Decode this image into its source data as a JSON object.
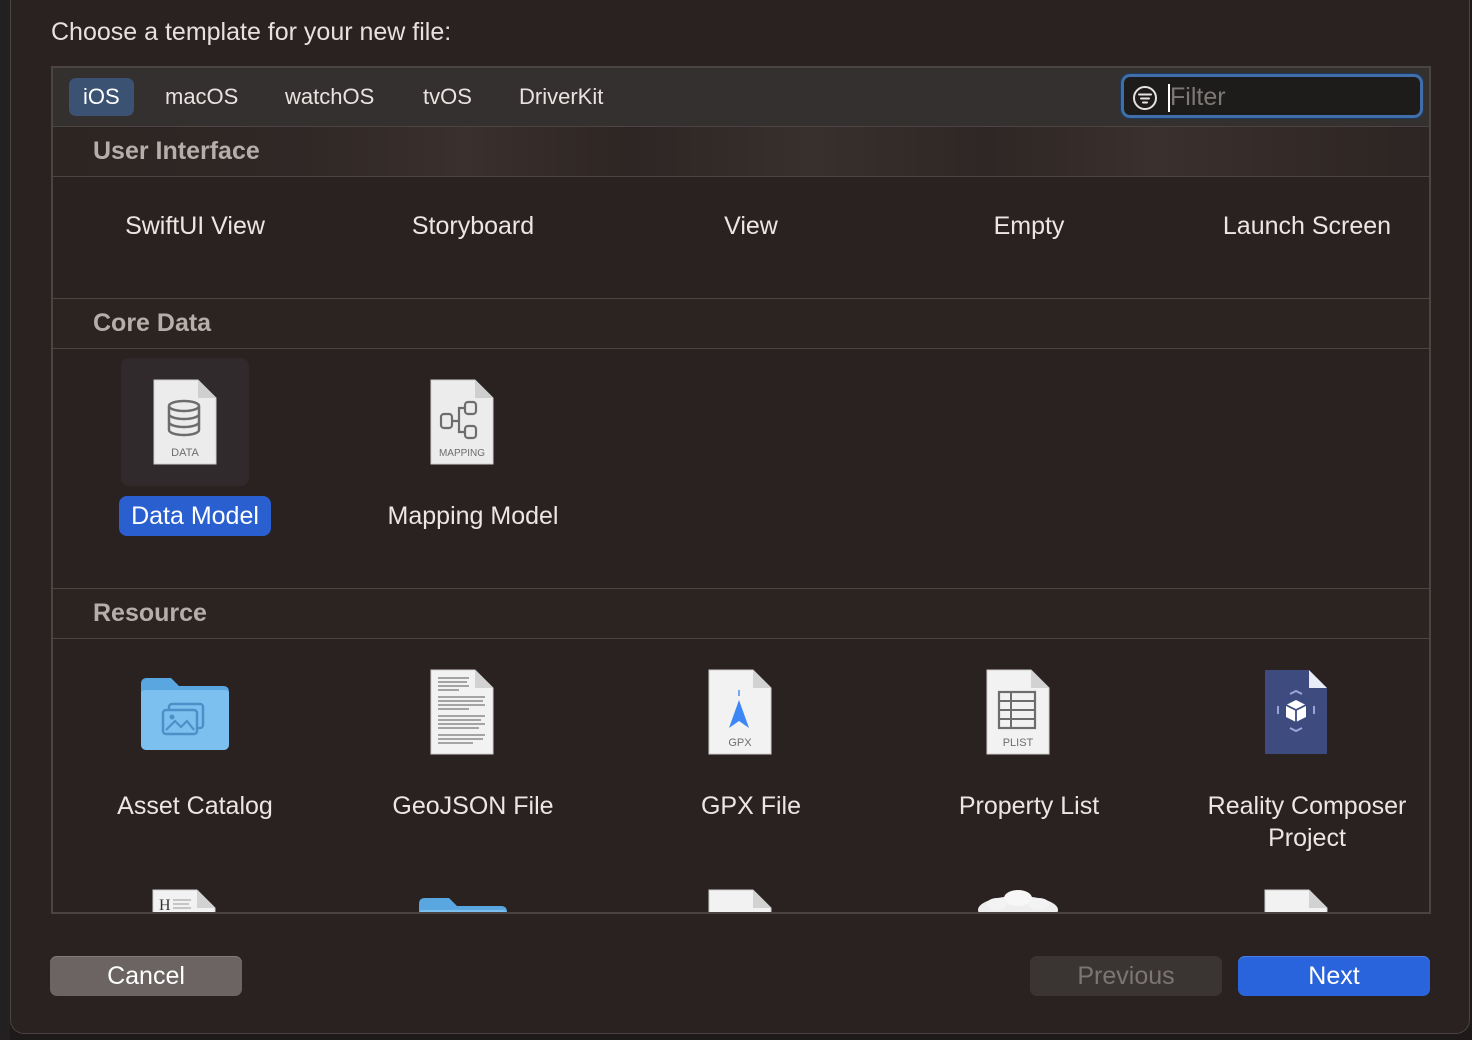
{
  "title": "Choose a template for your new file:",
  "tabs": [
    {
      "label": "iOS",
      "active": true
    },
    {
      "label": "macOS",
      "active": false
    },
    {
      "label": "watchOS",
      "active": false
    },
    {
      "label": "tvOS",
      "active": false
    },
    {
      "label": "DriverKit",
      "active": false
    }
  ],
  "filter": {
    "placeholder": "Filter",
    "value": ""
  },
  "sections": {
    "user_interface": {
      "header": "User Interface",
      "items": [
        "SwiftUI View",
        "Storyboard",
        "View",
        "Empty",
        "Launch Screen"
      ]
    },
    "core_data": {
      "header": "Core Data",
      "items": [
        {
          "label": "Data Model",
          "icon_text": "DATA",
          "icon": "database-icon",
          "selected": true
        },
        {
          "label": "Mapping Model",
          "icon_text": "MAPPING",
          "icon": "mapping-icon",
          "selected": false
        }
      ]
    },
    "resource": {
      "header": "Resource",
      "items": [
        {
          "label": "Asset Catalog",
          "icon": "folder-photos-icon"
        },
        {
          "label": "GeoJSON File",
          "icon": "text-document-icon"
        },
        {
          "label": "GPX File",
          "icon": "gpx-document-icon",
          "icon_text": "GPX"
        },
        {
          "label": "Property List",
          "icon": "plist-document-icon",
          "icon_text": "PLIST"
        },
        {
          "label": "Reality Composer Project",
          "label_lines": [
            "Reality Composer",
            "Project"
          ],
          "icon": "reality-composer-icon"
        }
      ]
    }
  },
  "buttons": {
    "cancel": "Cancel",
    "previous": "Previous",
    "next": "Next"
  },
  "colors": {
    "accent": "#2a64dc",
    "selection": "#2a5fd0",
    "tab_active": "#3b5272",
    "background": "#2a2220"
  }
}
